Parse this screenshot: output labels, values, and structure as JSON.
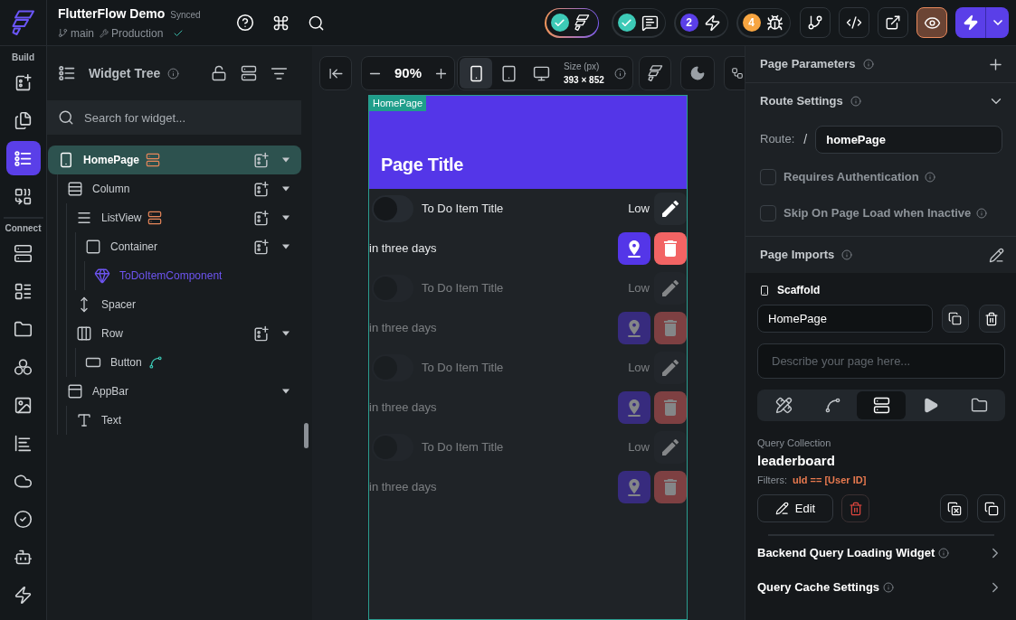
{
  "top_bar": {
    "project_name": "FlutterFlow Demo",
    "sync_status": "Synced",
    "branch": "main",
    "environment": "Production",
    "status_pills": [
      {
        "kind": "check",
        "color": "#3dcab7",
        "highlighted": true
      },
      {
        "kind": "check",
        "color": "#3dcab7",
        "highlighted": false
      },
      {
        "kind": "count",
        "count": "2",
        "color": "#5b3fe8",
        "highlighted": false
      },
      {
        "kind": "count",
        "count": "4",
        "color": "#f7a541",
        "highlighted": false
      }
    ],
    "tool_buttons": [
      {
        "active": false
      },
      {
        "active": false
      },
      {
        "active": false
      },
      {
        "active": true
      }
    ]
  },
  "rail": {
    "sections": [
      {
        "label": "Build",
        "items": [
          {
            "selected": false
          },
          {
            "selected": false
          },
          {
            "selected": true
          },
          {
            "selected": false
          }
        ]
      },
      {
        "label": "Connect",
        "items": [
          {
            "selected": false
          },
          {
            "selected": false
          },
          {
            "selected": false
          },
          {
            "selected": false
          },
          {
            "selected": false
          },
          {
            "selected": false
          },
          {
            "selected": false
          },
          {
            "selected": false
          },
          {
            "selected": false
          },
          {
            "selected": false
          }
        ]
      }
    ]
  },
  "widget_tree": {
    "title": "Widget Tree",
    "search_placeholder": "Search for widget...",
    "nodes": [
      {
        "label": "HomePage",
        "kind": "page",
        "selected": true,
        "query": true,
        "action": false,
        "addable": true,
        "expanded": true,
        "children": [
          {
            "label": "Column",
            "kind": "column",
            "selected": false,
            "query": false,
            "action": false,
            "addable": true,
            "expanded": true,
            "children": [
              {
                "label": "ListView",
                "kind": "listview",
                "selected": false,
                "query": true,
                "action": false,
                "addable": true,
                "expanded": true,
                "children": [
                  {
                    "label": "Container",
                    "kind": "container",
                    "selected": false,
                    "query": false,
                    "action": false,
                    "addable": true,
                    "expanded": true,
                    "children": [
                      {
                        "label": "ToDoItemComponent",
                        "kind": "component",
                        "selected": false,
                        "query": false,
                        "action": false,
                        "addable": false
                      }
                    ]
                  }
                ]
              },
              {
                "label": "Spacer",
                "kind": "spacer",
                "selected": false,
                "query": false,
                "action": false,
                "addable": false
              },
              {
                "label": "Row",
                "kind": "row",
                "selected": false,
                "query": false,
                "action": false,
                "addable": true,
                "expanded": true,
                "children": [
                  {
                    "label": "Button",
                    "kind": "button",
                    "selected": false,
                    "query": false,
                    "action": true,
                    "addable": false
                  }
                ]
              }
            ]
          },
          {
            "label": "AppBar",
            "kind": "appbar",
            "selected": false,
            "query": false,
            "action": false,
            "addable": false,
            "expanded": true,
            "children": [
              {
                "label": "Text",
                "kind": "text",
                "selected": false,
                "query": false,
                "action": false,
                "addable": false
              }
            ]
          }
        ]
      }
    ]
  },
  "canvas": {
    "toolbar": {
      "zoom": "90%",
      "devices": [
        {
          "selected": true
        },
        {
          "selected": false
        },
        {
          "selected": false
        }
      ],
      "size_label": "Size (px)",
      "size_value": "393 × 852"
    },
    "page": {
      "tag": "HomePage",
      "title": "Page Title",
      "items": [
        {
          "title": "To Do Item Title",
          "on": false,
          "priority": "Low",
          "due": "in three days",
          "faded": false
        },
        {
          "title": "To Do Item Title",
          "on": false,
          "priority": "Low",
          "due": "in three days",
          "faded": true
        },
        {
          "title": "To Do Item Title",
          "on": false,
          "priority": "Low",
          "due": "in three days",
          "faded": true
        },
        {
          "title": "To Do Item Title",
          "on": false,
          "priority": "Low",
          "due": "in three days",
          "faded": true
        }
      ]
    }
  },
  "properties": {
    "page_parameters": {
      "title": "Page Parameters"
    },
    "route_settings": {
      "title": "Route Settings",
      "expanded": true,
      "route_label": "Route:",
      "route_prefix": "/",
      "route_value": "homePage",
      "options": [
        {
          "label": "Requires Authentication",
          "checked": false
        },
        {
          "label": "Skip On Page Load when Inactive",
          "checked": false
        }
      ]
    },
    "page_imports": {
      "title": "Page Imports"
    },
    "scaffold": {
      "title": "Scaffold",
      "name_value": "HomePage",
      "description_placeholder": "Describe your page here...",
      "tabs": [
        {
          "selected": false
        },
        {
          "selected": false
        },
        {
          "selected": true
        },
        {
          "selected": false
        },
        {
          "selected": false
        }
      ]
    },
    "query": {
      "label": "Query Collection",
      "collection": "leaderboard",
      "filters_label": "Filters:",
      "filter": "uId == [User ID]",
      "edit_label": "Edit"
    },
    "sections": [
      {
        "title": "Backend Query Loading Widget",
        "expanded": false
      },
      {
        "title": "Query Cache Settings",
        "expanded": false
      }
    ]
  }
}
